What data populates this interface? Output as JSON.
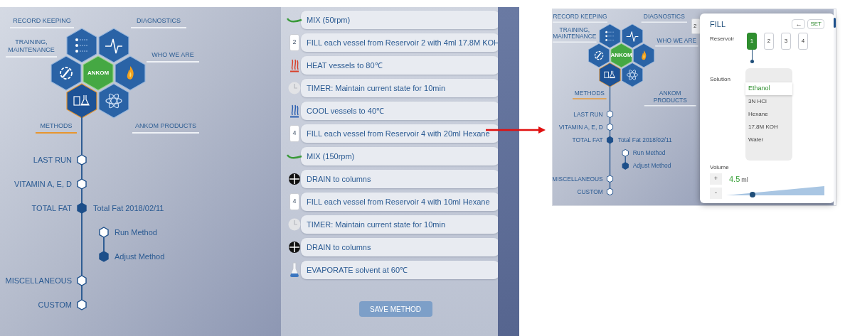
{
  "main_screen": {
    "hex_menu": [
      {
        "kind": "list",
        "label": "RECORD KEEPING",
        "selected": false
      },
      {
        "kind": "pulse",
        "label": "DIAGNOSTICS",
        "selected": false
      },
      {
        "kind": "wrench",
        "label": "TRAINING, MAINTENANCE",
        "selected": false
      },
      {
        "kind": "logo",
        "text": "ANKOM"
      },
      {
        "kind": "flame",
        "label": "WHO WE ARE",
        "selected": false
      },
      {
        "kind": "flask",
        "label": "METHODS",
        "selected": true
      },
      {
        "kind": "atom",
        "label": "ANKOM PRODUCTS",
        "selected": false
      }
    ],
    "method_tree": [
      {
        "label": "LAST RUN",
        "selected": false
      },
      {
        "label": "VITAMIN A, E, D",
        "selected": false
      },
      {
        "label": "TOTAL FAT",
        "selected": true,
        "children": [
          {
            "label": "Total Fat 2018/02/11",
            "children": [
              {
                "label": "Run Method",
                "selected": false
              },
              {
                "label": "Adjust Method",
                "selected": true
              }
            ]
          }
        ]
      },
      {
        "label": "MISCELLANEOUS",
        "selected": false
      },
      {
        "label": "CUSTOM",
        "selected": false
      }
    ],
    "steps": [
      {
        "kind": "mix",
        "text": "MIX (50rpm)"
      },
      {
        "kind": "fill",
        "badge": "2",
        "text": "FILL each vessel from Reservoir 2 with 4ml 17.8M KOH"
      },
      {
        "kind": "heat",
        "text": "HEAT vessels to 80℃"
      },
      {
        "kind": "timer",
        "text": "TIMER:  Maintain current state for 10min"
      },
      {
        "kind": "cool",
        "text": "COOL vessels to 40℃"
      },
      {
        "kind": "fill",
        "badge": "4",
        "text": "FILL each vessel from Reservoir 4 with 20ml Hexane"
      },
      {
        "kind": "mix",
        "text": "MIX (150rpm)"
      },
      {
        "kind": "drain",
        "text": "DRAIN to columns"
      },
      {
        "kind": "fill",
        "badge": "4",
        "text": "FILL each vessel from Reservoir 4 with 10ml Hexane"
      },
      {
        "kind": "timer",
        "text": "TIMER: Maintain current state for 10min"
      },
      {
        "kind": "drain",
        "text": "DRAIN to columns"
      },
      {
        "kind": "evaporate",
        "text": "EVAPORATE solvent at 60℃"
      }
    ],
    "save_button": {
      "label": "SAVE METHOD",
      "disabled": true
    }
  },
  "detail_screen": {
    "hex_menu": [
      {
        "kind": "list",
        "label": "RECORD KEEPING",
        "selected": false
      },
      {
        "kind": "pulse",
        "label": "DIAGNOSTICS",
        "selected": false
      },
      {
        "kind": "wrench",
        "label": "TRAINING, MAINTENANCE",
        "selected": false
      },
      {
        "kind": "logo",
        "text": "ANKOM"
      },
      {
        "kind": "flame",
        "label": "WHO WE ARE",
        "selected": false
      },
      {
        "kind": "flask",
        "label": "METHODS",
        "selected": true
      },
      {
        "kind": "atom",
        "label": "ANKOM PRODUCTS",
        "selected": false
      }
    ],
    "method_tree": [
      {
        "label": "LAST RUN",
        "selected": false
      },
      {
        "label": "VITAMIN A, E, D",
        "selected": false
      },
      {
        "label": "TOTAL FAT",
        "selected": true,
        "children": [
          {
            "label": "Total Fat 2018/02/11",
            "children": [
              {
                "label": "Run Method",
                "selected": false
              },
              {
                "label": "Adjust Method",
                "selected": true
              }
            ]
          }
        ]
      },
      {
        "label": "MISCELLANEOUS",
        "selected": false
      },
      {
        "label": "CUSTOM",
        "selected": false
      }
    ],
    "behind_step_badge": "2",
    "dialog": {
      "title": "FILL",
      "back_button": "←",
      "set_button": "SET",
      "reservoir_label": "Reservoir",
      "reservoirs": [
        {
          "label": "1",
          "selected": true
        },
        {
          "label": "2",
          "selected": false
        },
        {
          "label": "3",
          "selected": false
        },
        {
          "label": "4",
          "selected": false
        }
      ],
      "solution_label": "Solution",
      "solutions": [
        {
          "label": "Ethanol",
          "selected": true
        },
        {
          "label": "3N HCl",
          "selected": false
        },
        {
          "label": "Hexane",
          "selected": false
        },
        {
          "label": "17.8M KOH",
          "selected": false
        },
        {
          "label": "Water",
          "selected": false
        }
      ],
      "volume": {
        "label": "Volume",
        "increase": "+",
        "decrease": "-",
        "value": "4.5",
        "unit": "ml",
        "level": 0.27
      }
    }
  }
}
